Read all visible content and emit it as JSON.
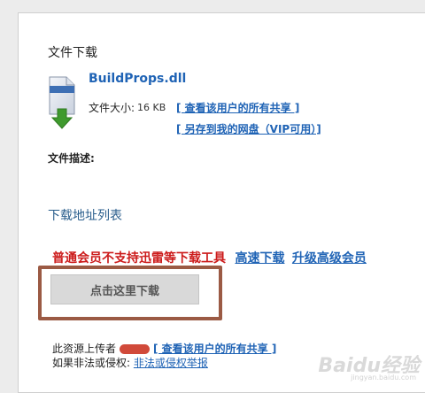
{
  "section": {
    "title": "文件下载"
  },
  "file": {
    "name": "BuildProps.dll",
    "size_label": "文件大小:",
    "size_value": "16 KB",
    "view_shares_link": "[ 查看该用户的所有共享 ]",
    "save_to_disk_link": "[ 另存到我的网盘（VIP可用）]",
    "description_label": "文件描述:",
    "icon": "file-download-icon"
  },
  "download_list": {
    "title": "下载地址列表",
    "warning_text": "普通会员不支持迅雷等下载工具",
    "high_speed_link": "高速下载",
    "upgrade_link": "升级高级会员",
    "download_button": "点击这里下载"
  },
  "footer": {
    "uploader_label": "此资源上传者",
    "uploader_view_link": "[ 查看该用户的所有共享 ]",
    "report_prefix": "如果非法或侵权:",
    "report_link": "非法或侵权举报"
  },
  "watermark": {
    "text": "Baidu经验",
    "sub": "jingyan.baidu.com"
  },
  "colors": {
    "link": "#1f63b5",
    "warning": "#cc1b1b",
    "highlight_border": "#9b5a44",
    "button_bg": "#d9d9d9"
  }
}
